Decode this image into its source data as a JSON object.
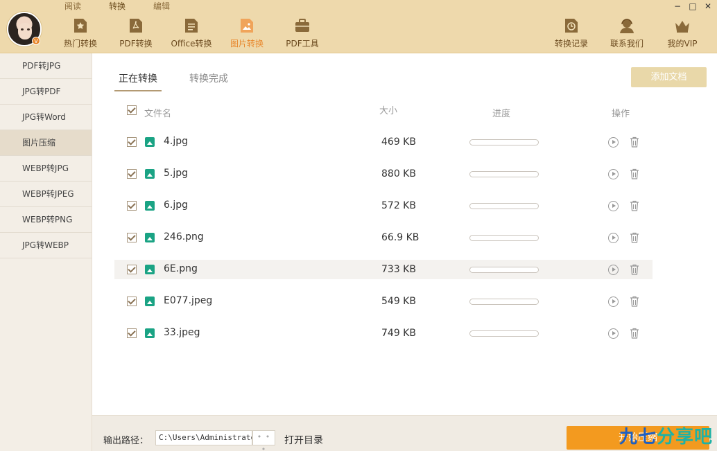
{
  "mode_tabs": [
    {
      "label": "阅读",
      "active": false
    },
    {
      "label": "转换",
      "active": true
    },
    {
      "label": "编辑",
      "active": false
    }
  ],
  "nav": [
    {
      "label": "热门转换",
      "icon": "star-doc-icon"
    },
    {
      "label": "PDF转换",
      "icon": "pdf-doc-icon"
    },
    {
      "label": "Office转换",
      "icon": "office-doc-icon"
    },
    {
      "label": "图片转换",
      "icon": "image-doc-icon",
      "active": true
    },
    {
      "label": "PDF工具",
      "icon": "toolbox-icon"
    }
  ],
  "nav_right": [
    {
      "label": "转换记录",
      "icon": "history-icon"
    },
    {
      "label": "联系我们",
      "icon": "support-icon"
    },
    {
      "label": "我的VIP",
      "icon": "crown-icon"
    }
  ],
  "window_controls": {
    "minimize": "−",
    "maximize": "□",
    "close": "✕"
  },
  "avatar_badge": "V",
  "sidebar": [
    {
      "label": "PDF转JPG"
    },
    {
      "label": "JPG转PDF"
    },
    {
      "label": "JPG转Word"
    },
    {
      "label": "图片压缩",
      "active": true
    },
    {
      "label": "WEBP转JPG"
    },
    {
      "label": "WEBP转JPEG"
    },
    {
      "label": "WEBP转PNG"
    },
    {
      "label": "JPG转WEBP"
    }
  ],
  "subtabs": [
    {
      "label": "正在转换",
      "active": true
    },
    {
      "label": "转换完成",
      "active": false
    }
  ],
  "add_button": "添加文档",
  "table": {
    "headers": {
      "name": "文件名",
      "size": "大小",
      "progress": "进度",
      "ops": "操作"
    },
    "rows": [
      {
        "name": "4.jpg",
        "size": "469 KB",
        "progress": 0,
        "checked": true
      },
      {
        "name": "5.jpg",
        "size": "880 KB",
        "progress": 0,
        "checked": true
      },
      {
        "name": "6.jpg",
        "size": "572 KB",
        "progress": 0,
        "checked": true
      },
      {
        "name": "246.png",
        "size": "66.9 KB",
        "progress": 0,
        "checked": true
      },
      {
        "name": "6E.png",
        "size": "733 KB",
        "progress": 0,
        "checked": true,
        "highlighted": true
      },
      {
        "name": "E077.jpeg",
        "size": "549 KB",
        "progress": 0,
        "checked": true
      },
      {
        "name": "33.jpeg",
        "size": "749 KB",
        "progress": 0,
        "checked": true
      }
    ]
  },
  "footer": {
    "output_label": "输出路径：",
    "output_path": "C:\\Users\\Administrator",
    "browse_label": "• • •",
    "open_dir": "打开目录",
    "start_button": "开始压缩",
    "watermark_a": "九七",
    "watermark_b": "分享吧"
  },
  "colors": {
    "topbar": "#eed9ac",
    "accent": "#e8862a",
    "start_button": "#f39a1f",
    "file_icon": "#1aa384"
  }
}
